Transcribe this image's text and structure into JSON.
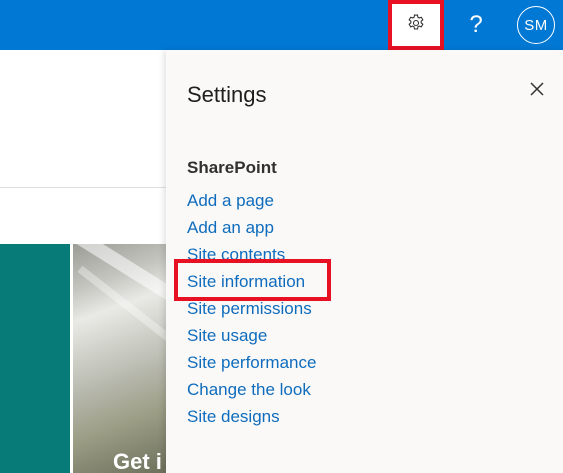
{
  "topbar": {
    "settings_icon": "gear-icon",
    "help_label": "?",
    "avatar_initials": "SM",
    "accent_color": "#0078d4",
    "highlight_color": "#e81123"
  },
  "background_page": {
    "hero_title": "Get i"
  },
  "settings_panel": {
    "title": "Settings",
    "close_icon": "close-icon",
    "section_heading": "SharePoint",
    "links": [
      {
        "label": "Add a page"
      },
      {
        "label": "Add an app"
      },
      {
        "label": "Site contents"
      },
      {
        "label": "Site information"
      },
      {
        "label": "Site permissions"
      },
      {
        "label": "Site usage"
      },
      {
        "label": "Site performance"
      },
      {
        "label": "Change the look"
      },
      {
        "label": "Site designs"
      }
    ]
  }
}
